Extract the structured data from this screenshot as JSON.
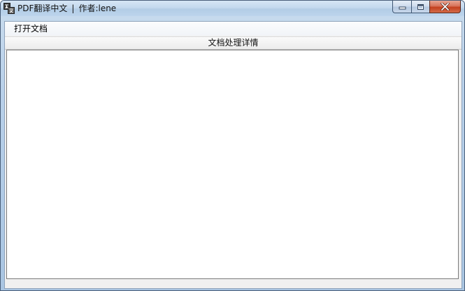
{
  "window": {
    "title_app": "PDF翻译中文",
    "title_separator": "|",
    "title_author": "作者:lene"
  },
  "menu": {
    "items": [
      {
        "label": "打开文档"
      }
    ]
  },
  "details": {
    "header": "文档处理详情",
    "content": ""
  },
  "colors": {
    "close_button": "#c4411f",
    "titlebar": "#c4d9ee",
    "client_bg": "#f0f0f0"
  },
  "icons": {
    "app": "translate-icon",
    "minimize": "minimize-icon",
    "maximize": "maximize-icon",
    "close": "close-icon"
  }
}
